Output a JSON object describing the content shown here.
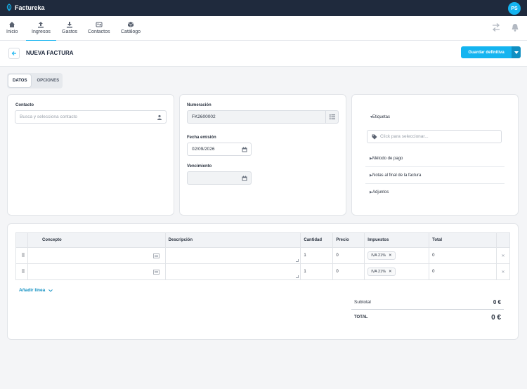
{
  "app": {
    "name": "Factureka",
    "avatar_initials": "PS",
    "accent": "#14b4f0",
    "topbar_color": "#1f2a3d"
  },
  "nav": [
    {
      "label": "Inicio",
      "icon": "home-icon"
    },
    {
      "label": "Ingresos",
      "icon": "upload-icon",
      "active": true
    },
    {
      "label": "Gastos",
      "icon": "download-icon"
    },
    {
      "label": "Contactos",
      "icon": "contacts-icon"
    },
    {
      "label": "Catálogo",
      "icon": "box-icon"
    }
  ],
  "header": {
    "title": "NUEVA FACTURA",
    "save_label": "Guardar definitiva"
  },
  "tabs": [
    {
      "label": "DATOS",
      "active": true
    },
    {
      "label": "OPCIONES"
    }
  ],
  "contact": {
    "label": "Contacto",
    "placeholder": "Busca y selecciona contacto"
  },
  "numbering": {
    "label": "Numeración",
    "value": "FK2600002"
  },
  "issue_date": {
    "label": "Fecha emisión",
    "value": "02/09/2026"
  },
  "due_date": {
    "label": "Vencimiento",
    "value": ""
  },
  "tags": {
    "label": "Etiquetas",
    "placeholder": "Click para seleccionar..."
  },
  "accordions": [
    "Método de pago",
    "Notas al final de la factura",
    "Adjuntos"
  ],
  "table": {
    "headers": {
      "concept": "Concepto",
      "description": "Descripción",
      "qty": "Cantidad",
      "price": "Precio",
      "taxes": "Impuestos",
      "total": "Total"
    },
    "rows": [
      {
        "concept": "",
        "description": "",
        "qty": "1",
        "price": "0",
        "tax": "IVA 21%",
        "total": "0"
      },
      {
        "concept": "",
        "description": "",
        "qty": "1",
        "price": "0",
        "tax": "IVA 21%",
        "total": "0"
      }
    ]
  },
  "add_line_label": "Añadir línea",
  "totals": {
    "subtotal_label": "Subtotal",
    "subtotal_value": "0 €",
    "total_label": "TOTAL",
    "total_value": "0 €"
  }
}
